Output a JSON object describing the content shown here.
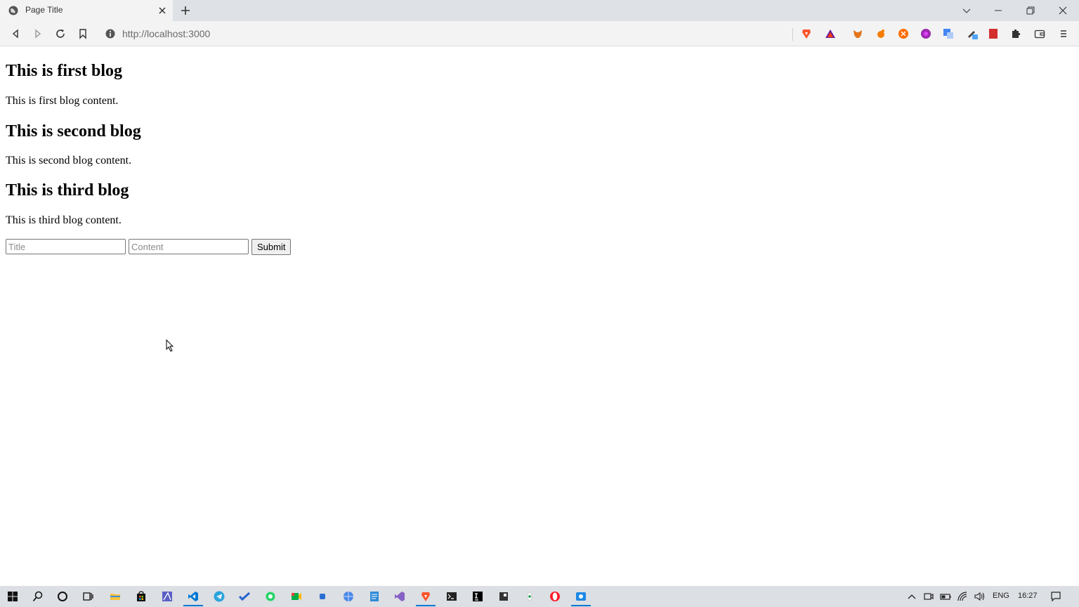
{
  "browser": {
    "tab_title": "Page Title",
    "url": "http://localhost:3000"
  },
  "page": {
    "blogs": [
      {
        "title": "This is first blog",
        "content": "This is first blog content."
      },
      {
        "title": "This is second blog",
        "content": "This is second blog content."
      },
      {
        "title": "This is third blog",
        "content": "This is third blog content."
      }
    ],
    "form": {
      "title_placeholder": "Title",
      "content_placeholder": "Content",
      "submit_label": "Submit"
    }
  },
  "taskbar": {
    "language": "ENG",
    "time": "16:27"
  },
  "colors": {
    "brave_orange": "#fb542b",
    "vscode_blue": "#0078d4"
  }
}
